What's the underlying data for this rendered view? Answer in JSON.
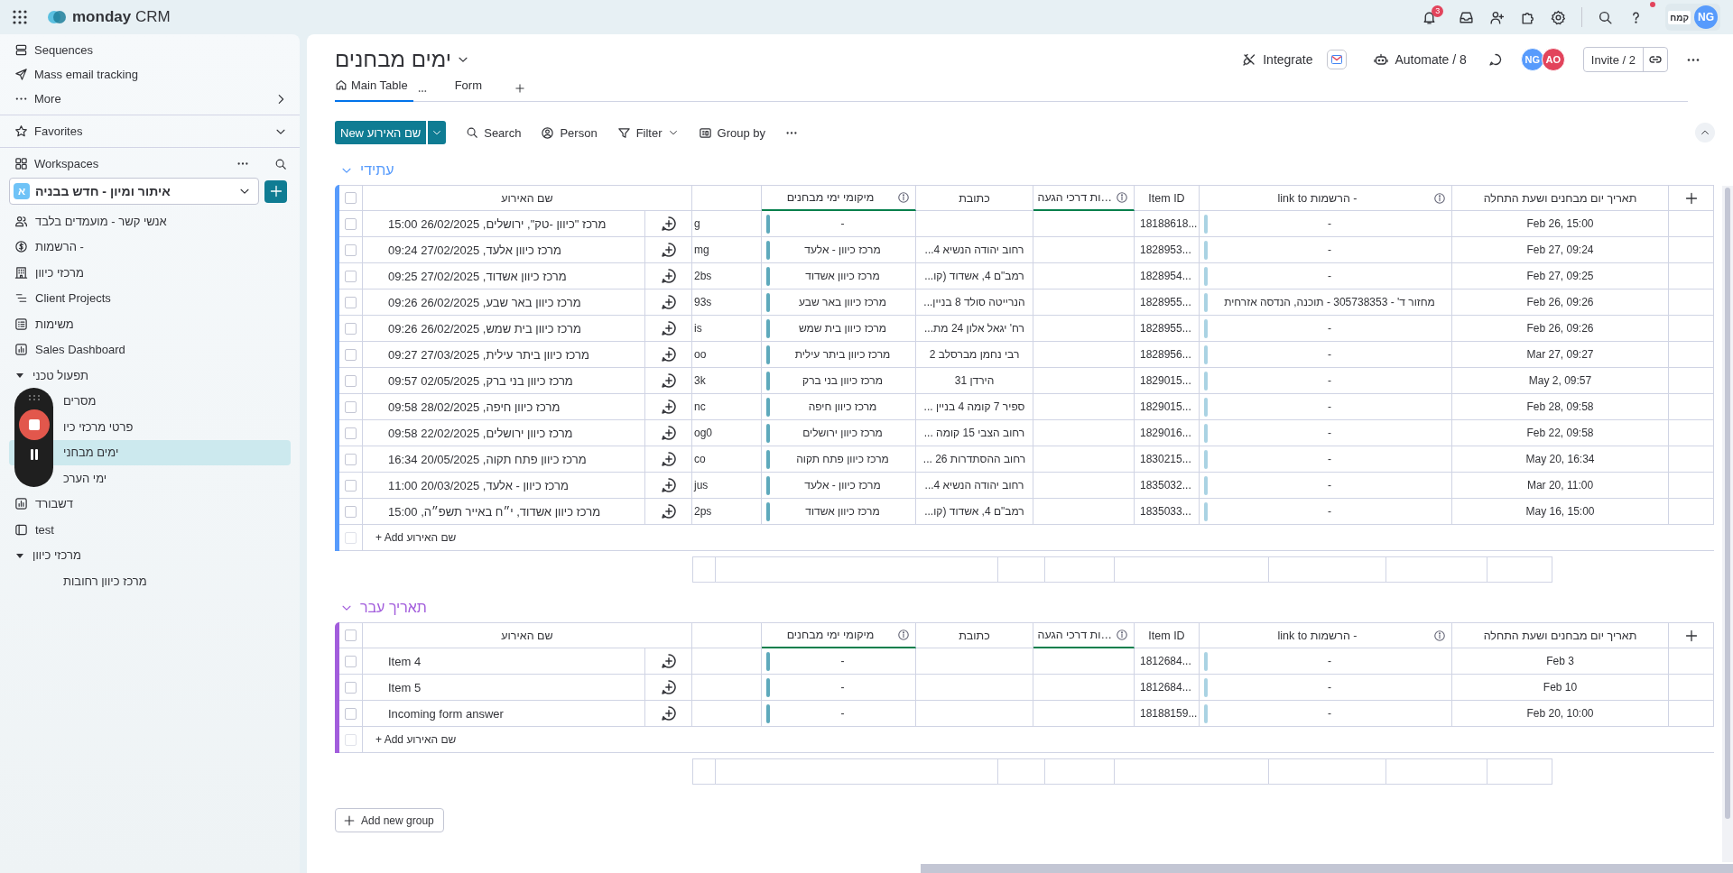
{
  "topbar": {
    "brand": "monday",
    "product": "CRM",
    "notifications": "3",
    "org_logo": "קמח",
    "avatar": "NG"
  },
  "sidebar": {
    "items": [
      {
        "label": "Sequences"
      },
      {
        "label": "Mass email tracking"
      },
      {
        "label": "More"
      }
    ],
    "favorites": "Favorites",
    "workspaces": "Workspaces",
    "workspace": {
      "badge": "א",
      "name": "איתור ומיון - חדש בבניה"
    },
    "boards": [
      {
        "label": "אנשי קשר - מועמדים בלבד",
        "selected": false
      },
      {
        "label": "הרשמות -",
        "selected": false
      },
      {
        "label": "מרכזי כיוון",
        "selected": false
      },
      {
        "label": "Client Projects",
        "selected": false
      },
      {
        "label": "משימות",
        "selected": false
      },
      {
        "label": "Sales Dashboard",
        "selected": false
      },
      {
        "label": "תפעול טכני",
        "selected": false,
        "expanded": true,
        "children": [
          {
            "label": "מסרים",
            "selected": false
          },
          {
            "label": "פרטי מרכזי כיו",
            "selected": false
          },
          {
            "label": "ימים מבחני",
            "selected": true
          },
          {
            "label": "ימי הערכ",
            "selected": false
          }
        ]
      },
      {
        "label": "דשבורד",
        "selected": false
      },
      {
        "label": "test",
        "selected": false
      },
      {
        "label": "מרכזי כיוון",
        "selected": false,
        "expanded": true,
        "children": [
          {
            "label": "מרכז כיוון רחובות",
            "selected": false
          }
        ]
      }
    ]
  },
  "board": {
    "title": "ימים מבחנים",
    "integrate": "Integrate",
    "automate": "Automate / 8",
    "members": {
      "left": {
        "initials": "NG",
        "color": "#579bfc"
      },
      "right": {
        "initials": "AO",
        "color": "#e2445c"
      }
    },
    "invite": "Invite / 2",
    "tabs": {
      "main_table": {
        "label": "Main Table",
        "selected": true
      },
      "form": {
        "label": "Form",
        "selected": false
      }
    },
    "toolbar": {
      "new": "New שם האירוע",
      "search": "Search",
      "person": "Person",
      "filter": "Filter",
      "group_by": "Group by"
    },
    "groups": [
      {
        "title": "עתידי",
        "color": "#579bfc",
        "checked": false,
        "add_row": "+ Add שם האירוע",
        "add_row_checkbox": {
          "disabled": true
        },
        "columns": {
          "name": {
            "label": "שם האירוע",
            "info": false,
            "accent": false
          },
          "location": {
            "label": "מיקומי ימי מבחנים",
            "info": true,
            "accent": true
          },
          "address": {
            "label": "כתובת",
            "info": false,
            "accent": false
          },
          "arrival": {
            "label": "…ות דרכי הגעה",
            "info": true,
            "accent": true
          },
          "item_id": {
            "label": "Item ID",
            "info": false,
            "accent": false
          },
          "link": {
            "label": "- הרשמות link to",
            "info": true,
            "accent": false
          },
          "date": {
            "label": "תאריך יום מבחנים ושעת התחלה",
            "info": false,
            "accent": false
          }
        },
        "rows": [
          {
            "checked": false,
            "name": "מרכז \"כיוון -טק\", ירושלים, 26/02/2025 15:00",
            "column_3": "g",
            "location": "-",
            "item_id": "18188618...",
            "link": "-",
            "date": "Feb 26, 15:00"
          },
          {
            "checked": false,
            "name": "מרכז כיוון אלעד, 27/02/2025 09:24",
            "column_3": "mg",
            "location": "מרכז כיוון - אלעד",
            "address": "רחוב יהודה הנשיא 4...",
            "item_id": "1828953...",
            "link": "-",
            "date": "Feb 27, 09:24"
          },
          {
            "checked": false,
            "name": "מרכז כיוון אשדוד, 27/02/2025 09:25",
            "column_3": "2bs",
            "location": "מרכז כיוון אשדוד",
            "address": "רמב\"ם 4, אשדוד (קו...",
            "item_id": "1828954...",
            "link": "-",
            "date": "Feb 27, 09:25"
          },
          {
            "checked": false,
            "name": "מרכז כיוון באר שבע, 26/02/2025 09:26",
            "column_3": "93s",
            "location": "מרכז כיוון באר שבע",
            "address": "הנרייטה סולד 8 בניין...",
            "item_id": "1828955...",
            "link": "מחזור ד' - 305738353 - תוכנה, הנדסה אזרחית",
            "date": "Feb 26, 09:26"
          },
          {
            "checked": false,
            "name": "מרכז כיוון בית שמש, 26/02/2025 09:26",
            "column_3": "is",
            "location": "מרכז כיוון בית שמש",
            "address": "רח' יגאל אלון 24 מת...",
            "item_id": "1828955...",
            "link": "-",
            "date": "Feb 26, 09:26"
          },
          {
            "checked": false,
            "name": "מרכז כיוון ביתר עילית, 27/03/2025 09:27",
            "column_3": "oo",
            "location": "מרכז כיוון ביתר עילית",
            "address": "רבי נחמן מברסלב 2",
            "item_id": "1828956...",
            "link": "-",
            "date": "Mar 27, 09:27"
          },
          {
            "checked": false,
            "name": "מרכז כיוון בני ברק, 02/05/2025 09:57",
            "column_3": "3k",
            "location": "מרכז כיוון בני ברק",
            "address": "הירדן 31",
            "item_id": "1829015...",
            "link": "-",
            "date": "May 2, 09:57"
          },
          {
            "checked": false,
            "name": "מרכז כיוון חיפה, 28/02/2025 09:58",
            "column_3": "nc",
            "location": "מרכז כיוון חיפה",
            "address": "ספיר 7 קומה 4 בניין ...",
            "item_id": "1829015...",
            "link": "-",
            "date": "Feb 28, 09:58"
          },
          {
            "checked": false,
            "name": "מרכז כיוון ירושלים, 22/02/2025 09:58",
            "column_3": "og0",
            "location": "מרכז כיוון ירושלים",
            "address": "רחוב הצבי 15 קומה ...",
            "item_id": "1829016...",
            "link": "-",
            "date": "Feb 22, 09:58"
          },
          {
            "checked": false,
            "name": "מרכז כיוון פתח תקוה, 20/05/2025 16:34",
            "column_3": "co",
            "location": "מרכז כיוון פתח תקוה",
            "address": "רחוב ההסתדרות 26 ...",
            "item_id": "1830215...",
            "link": "-",
            "date": "May 20, 16:34"
          },
          {
            "checked": false,
            "name": "מרכז כיוון - אלעד, 20/03/2025 11:00",
            "column_3": "jus",
            "location": "מרכז כיוון - אלעד",
            "address": "רחוב יהודה הנשיא 4...",
            "item_id": "1835032...",
            "link": "-",
            "date": "Mar 20, 11:00"
          },
          {
            "checked": false,
            "name": "מרכז כיוון אשדוד, י״ח באייר תשפ״ה, 15:00",
            "column_3": "2ps",
            "location": "מרכז כיוון אשדוד",
            "address": "רמב\"ם 4, אשדוד (קו...",
            "item_id": "1835033...",
            "link": "-",
            "date": "May 16, 15:00"
          }
        ]
      },
      {
        "title": "תאריך עבר",
        "color": "#a25ddc",
        "checked": false,
        "add_row": "+ Add שם האירוע",
        "add_row_checkbox": {
          "disabled": true
        },
        "columns": {
          "name": {
            "label": "שם האירוע",
            "info": false,
            "accent": false
          },
          "location": {
            "label": "מיקומי ימי מבחנים",
            "info": true,
            "accent": true
          },
          "address": {
            "label": "כתובת",
            "info": false,
            "accent": false
          },
          "arrival": {
            "label": "…ות דרכי הגעה",
            "info": true,
            "accent": true
          },
          "item_id": {
            "label": "Item ID",
            "info": false,
            "accent": false
          },
          "link": {
            "label": "- הרשמות link to",
            "info": true,
            "accent": false
          },
          "date": {
            "label": "תאריך יום מבחנים ושעת התחלה",
            "info": false,
            "accent": false
          }
        },
        "rows": [
          {
            "checked": false,
            "name": "Item 4",
            "location": "-",
            "item_id": "1812684...",
            "link": "-",
            "date": "Feb 3"
          },
          {
            "checked": false,
            "name": "Item 5",
            "location": "-",
            "item_id": "1812684...",
            "link": "-",
            "date": "Feb 10"
          },
          {
            "checked": false,
            "name": "Incoming form answer",
            "location": "-",
            "item_id": "18188159...",
            "link": "-",
            "date": "Feb 20, 10:00"
          }
        ]
      }
    ],
    "add_group": "Add new group"
  }
}
